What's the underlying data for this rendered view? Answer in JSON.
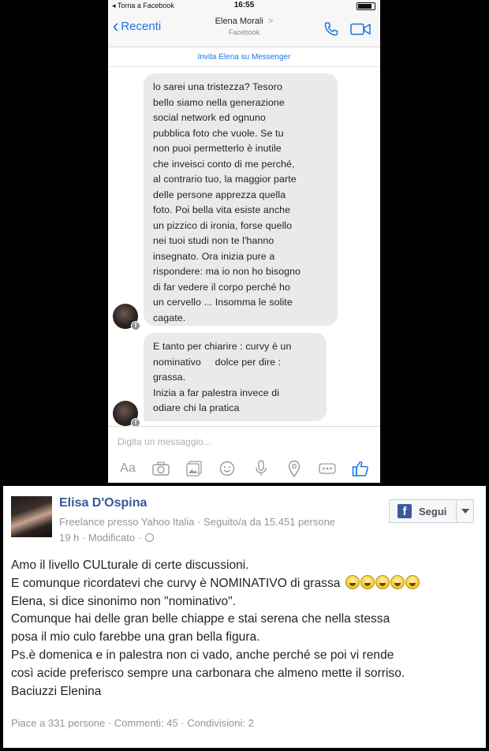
{
  "phone": {
    "status_back": "◂ Torna a Facebook",
    "status_time": "16:55",
    "back_label": "Recenti",
    "contact_name": "Elena Morali",
    "contact_chevron": ">",
    "contact_sub": "Facebook",
    "invite": "Invita Elena su Messenger",
    "messages": [
      {
        "lines": [
          "lo sarei una tristezza? Tesoro",
          "bello siamo nella generazione",
          "social network ed ognuno",
          "pubblica foto che vuole. Se tu",
          "non puoi permetterlo è inutile",
          "che inveisci conto di me perché,",
          "al contrario tuo, la maggior parte",
          "delle persone apprezza quella",
          "foto. Poi bella vita esiste anche",
          "un pizzico di ironia, forse quello",
          "nei tuoi studi non te l'hanno",
          "insegnato. Ora inizia pure a",
          "rispondere: ma io non ho bisogno",
          "di far vedere il corpo perché ho",
          "un cervello ... Insomma le solite",
          "cagate."
        ]
      },
      {
        "lines": [
          "E tanto per chiarire : curvy è un",
          "nominativo     dolce per dire :",
          "grassa.",
          "Inizia a far palestra invece di",
          "odiare chi la pratica"
        ]
      }
    ],
    "composer_placeholder": "Digita un messaggio...",
    "toolbar_icons": [
      "text-format-icon",
      "camera-icon",
      "gallery-icon",
      "emoji-icon",
      "microphone-icon",
      "location-icon",
      "more-icon",
      "like-icon"
    ],
    "aa_label": "Aa",
    "accent": "#1b74e4"
  },
  "post": {
    "author": "Elisa D'Ospina",
    "meta": "Freelance presso Yahoo Italia · Seguito/a da 15.451 persone",
    "time": "19 h · Modificato ·",
    "follow_label": "Segui",
    "body_lines": [
      "Amo il livello CULturale di certe discussioni.",
      "E comunque ricordatevi che curvy è NOMINATIVO di grassa",
      "Elena, si dice sinonimo non \"nominativo\".",
      "Comunque hai delle gran belle chiappe e stai serena che nella stessa",
      "posa il mio culo farebbe una gran bella figura.",
      "Ps.è domenica e in palestra non ci vado, anche perché se poi vi rende",
      "così acide preferisco sempre una carbonara che almeno mette il sorriso.",
      "Baciuzzi Elenina"
    ],
    "emoji_count": 5,
    "stats": "Piace a 331 persone · Commenti: 45 · Condivisioni: 2",
    "name_color": "#365899"
  }
}
